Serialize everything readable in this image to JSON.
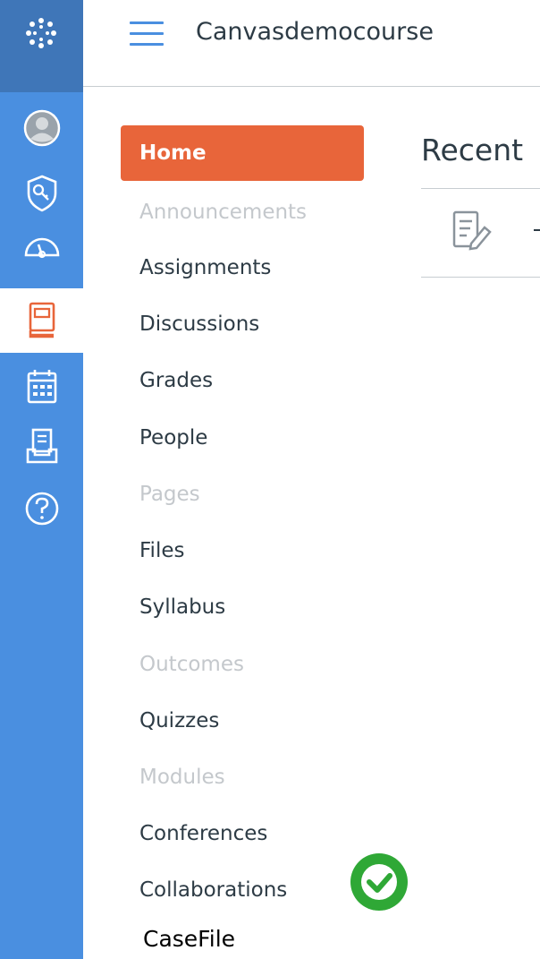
{
  "global_nav": {
    "logo_icon": "canvas-logo-icon",
    "items": [
      {
        "name": "account",
        "icon": "avatar-icon"
      },
      {
        "name": "admin",
        "icon": "shield-key-icon"
      },
      {
        "name": "dashboard",
        "icon": "speedometer-icon"
      },
      {
        "name": "courses",
        "icon": "book-icon",
        "active": true
      },
      {
        "name": "calendar",
        "icon": "calendar-icon"
      },
      {
        "name": "inbox",
        "icon": "inbox-icon"
      },
      {
        "name": "help",
        "icon": "question-circle-icon"
      }
    ],
    "colors": {
      "bar": "#4a8fe0",
      "logo_bg": "#3f76b8",
      "active_icon": "#e8653a"
    }
  },
  "header": {
    "course_title": "Canvasdemocourse",
    "menu_icon": "hamburger-icon"
  },
  "course_nav": {
    "items": [
      {
        "label": "Home",
        "state": "active"
      },
      {
        "label": "Announcements",
        "state": "disabled"
      },
      {
        "label": "Assignments",
        "state": "enabled"
      },
      {
        "label": "Discussions",
        "state": "enabled"
      },
      {
        "label": "Grades",
        "state": "enabled"
      },
      {
        "label": "People",
        "state": "enabled"
      },
      {
        "label": "Pages",
        "state": "disabled"
      },
      {
        "label": "Files",
        "state": "enabled"
      },
      {
        "label": "Syllabus",
        "state": "enabled"
      },
      {
        "label": "Outcomes",
        "state": "disabled"
      },
      {
        "label": "Quizzes",
        "state": "enabled"
      },
      {
        "label": "Modules",
        "state": "disabled"
      },
      {
        "label": "Conferences",
        "state": "enabled"
      },
      {
        "label": "Collaborations",
        "state": "enabled"
      }
    ],
    "active_color": "#e8653a"
  },
  "main": {
    "recent_title": "Recent",
    "recent_item_icon": "assignment-edit-icon"
  },
  "overlay": {
    "casefile_label": "CaseFile",
    "badge_icon": "checkmark-badge-icon",
    "badge_color": "#2fa836"
  }
}
